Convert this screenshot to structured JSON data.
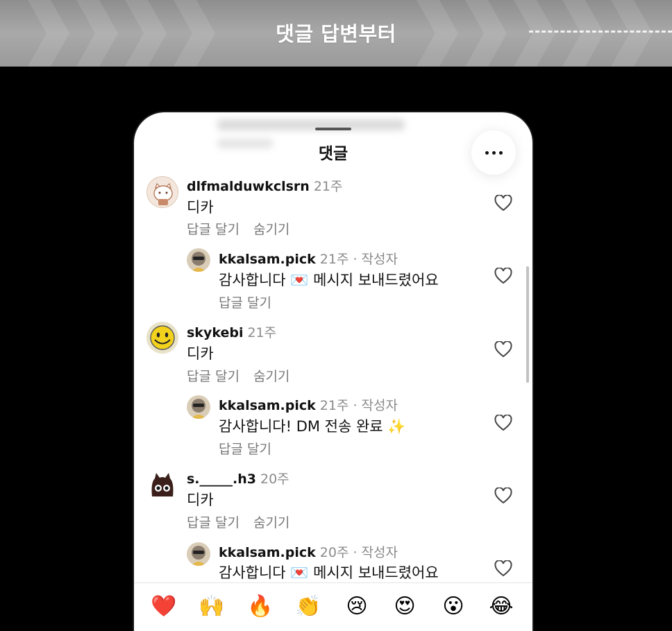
{
  "banner": {
    "title": "댓글 답변부터"
  },
  "sheet": {
    "title": "댓글",
    "more_icon": "more-horizontal-icon"
  },
  "comments": [
    {
      "username": "dlfmalduwkclsrn",
      "time": "21주",
      "text": "디카",
      "reply_label": "답글 달기",
      "hide_label": "숨기기"
    },
    {
      "username": "kkalsam.pick",
      "time": "21주 · 작성자",
      "text": "감사합니다 💌 메시지 보내드렸어요",
      "reply_label": "답글 달기"
    },
    {
      "username": "skykebi",
      "time": "21주",
      "text": "디카",
      "reply_label": "답글 달기",
      "hide_label": "숨기기"
    },
    {
      "username": "kkalsam.pick",
      "time": "21주 · 작성자",
      "text": "감사합니다! DM 전송 완료 ✨",
      "reply_label": "답글 달기"
    },
    {
      "username": "s._____.h3",
      "time": "20주",
      "text": "디카",
      "reply_label": "답글 달기",
      "hide_label": "숨기기"
    },
    {
      "username": "kkalsam.pick",
      "time": "20주 · 작성자",
      "text": "감사합니다 💌 메시지 보내드렸어요"
    }
  ],
  "emojis": [
    "❤️",
    "🙌",
    "🔥",
    "👏",
    "😢",
    "😍",
    "😮",
    "😂"
  ],
  "colors": {
    "text": "#111111",
    "meta": "#8a8a8a",
    "heart_red": "#e0241b"
  }
}
